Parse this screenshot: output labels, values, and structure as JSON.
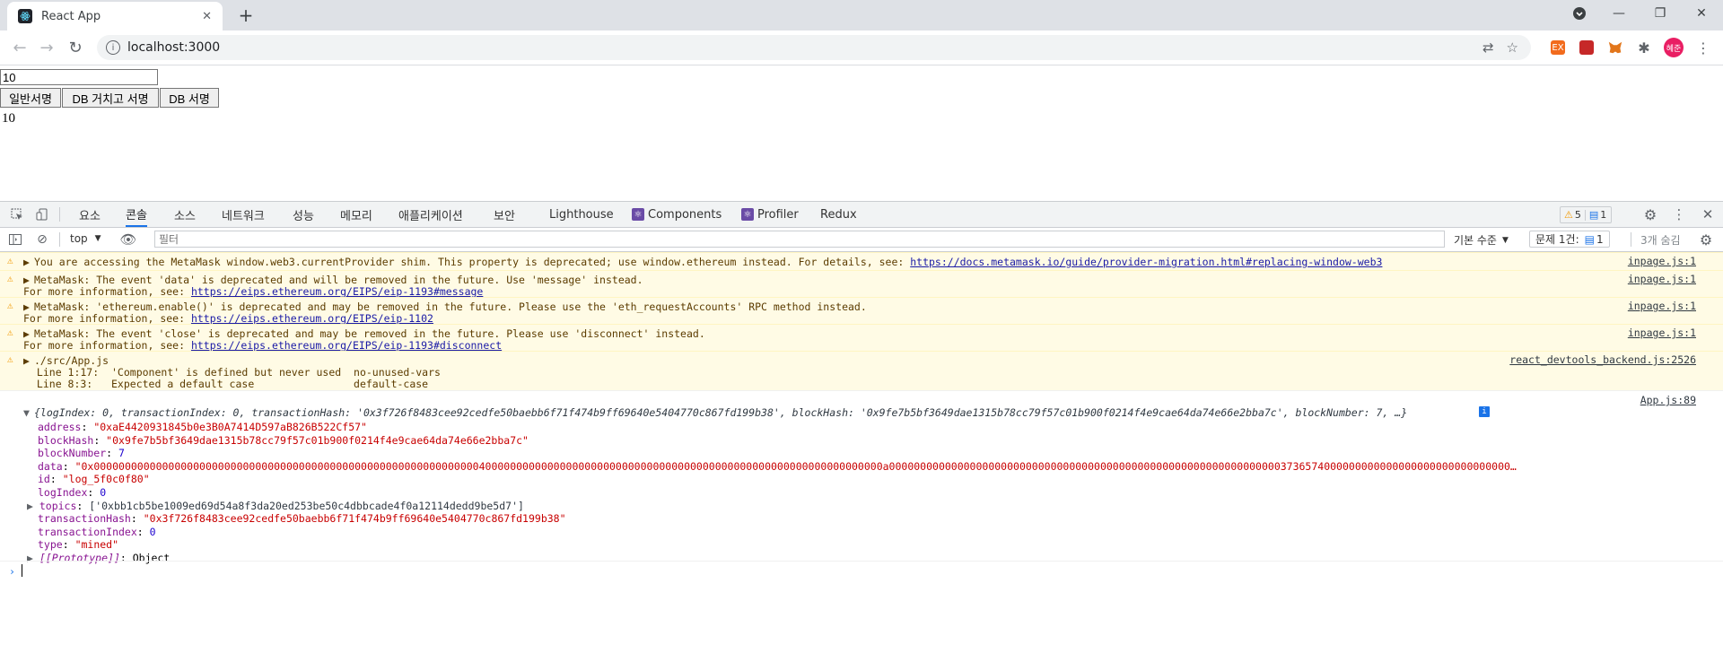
{
  "browser": {
    "tab_title": "React App",
    "address": "localhost:3000",
    "profile_initials": "혜준"
  },
  "page": {
    "input_value": "10",
    "buttons": [
      "일반서명",
      "DB 거치고 서명",
      "DB 서명"
    ],
    "result": "10"
  },
  "devtools": {
    "tabs": [
      "요소",
      "콘솔",
      "소스",
      "네트워크",
      "성능",
      "메모리",
      "애플리케이션",
      "보안",
      "Lighthouse",
      "Components",
      "Profiler",
      "Redux"
    ],
    "active_tab": "콘솔",
    "warnings_count": "5",
    "messages_count": "1",
    "context": "top",
    "filter_placeholder": "필터",
    "level": "기본 수준",
    "issues": "문제 1건:",
    "issues_count": "1",
    "hidden": "3개 숨김"
  },
  "console": {
    "warnings": [
      {
        "lines": [
          "You are accessing the MetaMask window.web3.currentProvider shim. This property is deprecated; use window.ethereum instead. For details, see: "
        ],
        "link": "https://docs.metamask.io/guide/provider-migration.html#replacing-window-web3",
        "source": "inpage.js:1"
      },
      {
        "lines": [
          "MetaMask: The event 'data' is deprecated and will be removed in the future. Use 'message' instead.",
          "For more information, see: "
        ],
        "link": "https://eips.ethereum.org/EIPS/eip-1193#message",
        "source": "inpage.js:1"
      },
      {
        "lines": [
          "MetaMask: 'ethereum.enable()' is deprecated and may be removed in the future. Please use the 'eth_requestAccounts' RPC method instead.",
          "For more information, see: "
        ],
        "link": "https://eips.ethereum.org/EIPS/eip-1102",
        "source": "inpage.js:1"
      },
      {
        "lines": [
          "MetaMask: The event 'close' is deprecated and may be removed in the future. Please use 'disconnect' instead.",
          "For more information, see: "
        ],
        "link": "https://eips.ethereum.org/EIPS/eip-1193#disconnect",
        "source": "inpage.js:1"
      },
      {
        "lines": [
          "./src/App.js",
          " Line 1:17:  'Component' is defined but never used  no-unused-vars",
          " Line 8:3:   Expected a default case                default-case"
        ],
        "link": "",
        "source": "react_devtools_backend.js:2526"
      }
    ],
    "object_source": "App.js:89",
    "object_summary": "{logIndex: 0, transactionIndex: 0, transactionHash: '0x3f726f8483cee92cedfe50baebb6f71f474b9ff69640e5404770c867fd199b38', blockHash: '0x9fe7b5bf3649dae1315b78cc79f57c01b900f0214f4e9cae64da74e66e2bba7c', blockNumber: 7, …}",
    "properties": [
      {
        "key": "address",
        "value": "\"0xaE4420931845b0e3B0A7414D597aB826B522Cf57\"",
        "kind": "str"
      },
      {
        "key": "blockHash",
        "value": "\"0x9fe7b5bf3649dae1315b78cc79f57c01b900f0214f4e9cae64da74e66e2bba7c\"",
        "kind": "str"
      },
      {
        "key": "blockNumber",
        "value": "7",
        "kind": "num"
      },
      {
        "key": "data",
        "value": "\"0x0000000000000000000000000000000000000000000000000000000000000040000000000000000000000000000000000000000000000000000000000000000a0000000000000000000000000000000000000000000000000000000000000003736574000000000000000000000000000000…",
        "kind": "str"
      },
      {
        "key": "id",
        "value": "\"log_5f0c0f80\"",
        "kind": "str"
      },
      {
        "key": "logIndex",
        "value": "0",
        "kind": "num"
      },
      {
        "key": "topics",
        "value": "['0xbb1cb5be1009ed69d54a8f3da20ed253be50c4dbbcade4f0a12114dedd9be5d7']",
        "kind": "arr"
      },
      {
        "key": "transactionHash",
        "value": "\"0x3f726f8483cee92cedfe50baebb6f71f474b9ff69640e5404770c867fd199b38\"",
        "kind": "str"
      },
      {
        "key": "transactionIndex",
        "value": "0",
        "kind": "num"
      },
      {
        "key": "type",
        "value": "\"mined\"",
        "kind": "str"
      },
      {
        "key": "[[Prototype]]",
        "value": "Object",
        "kind": "proto"
      }
    ]
  }
}
